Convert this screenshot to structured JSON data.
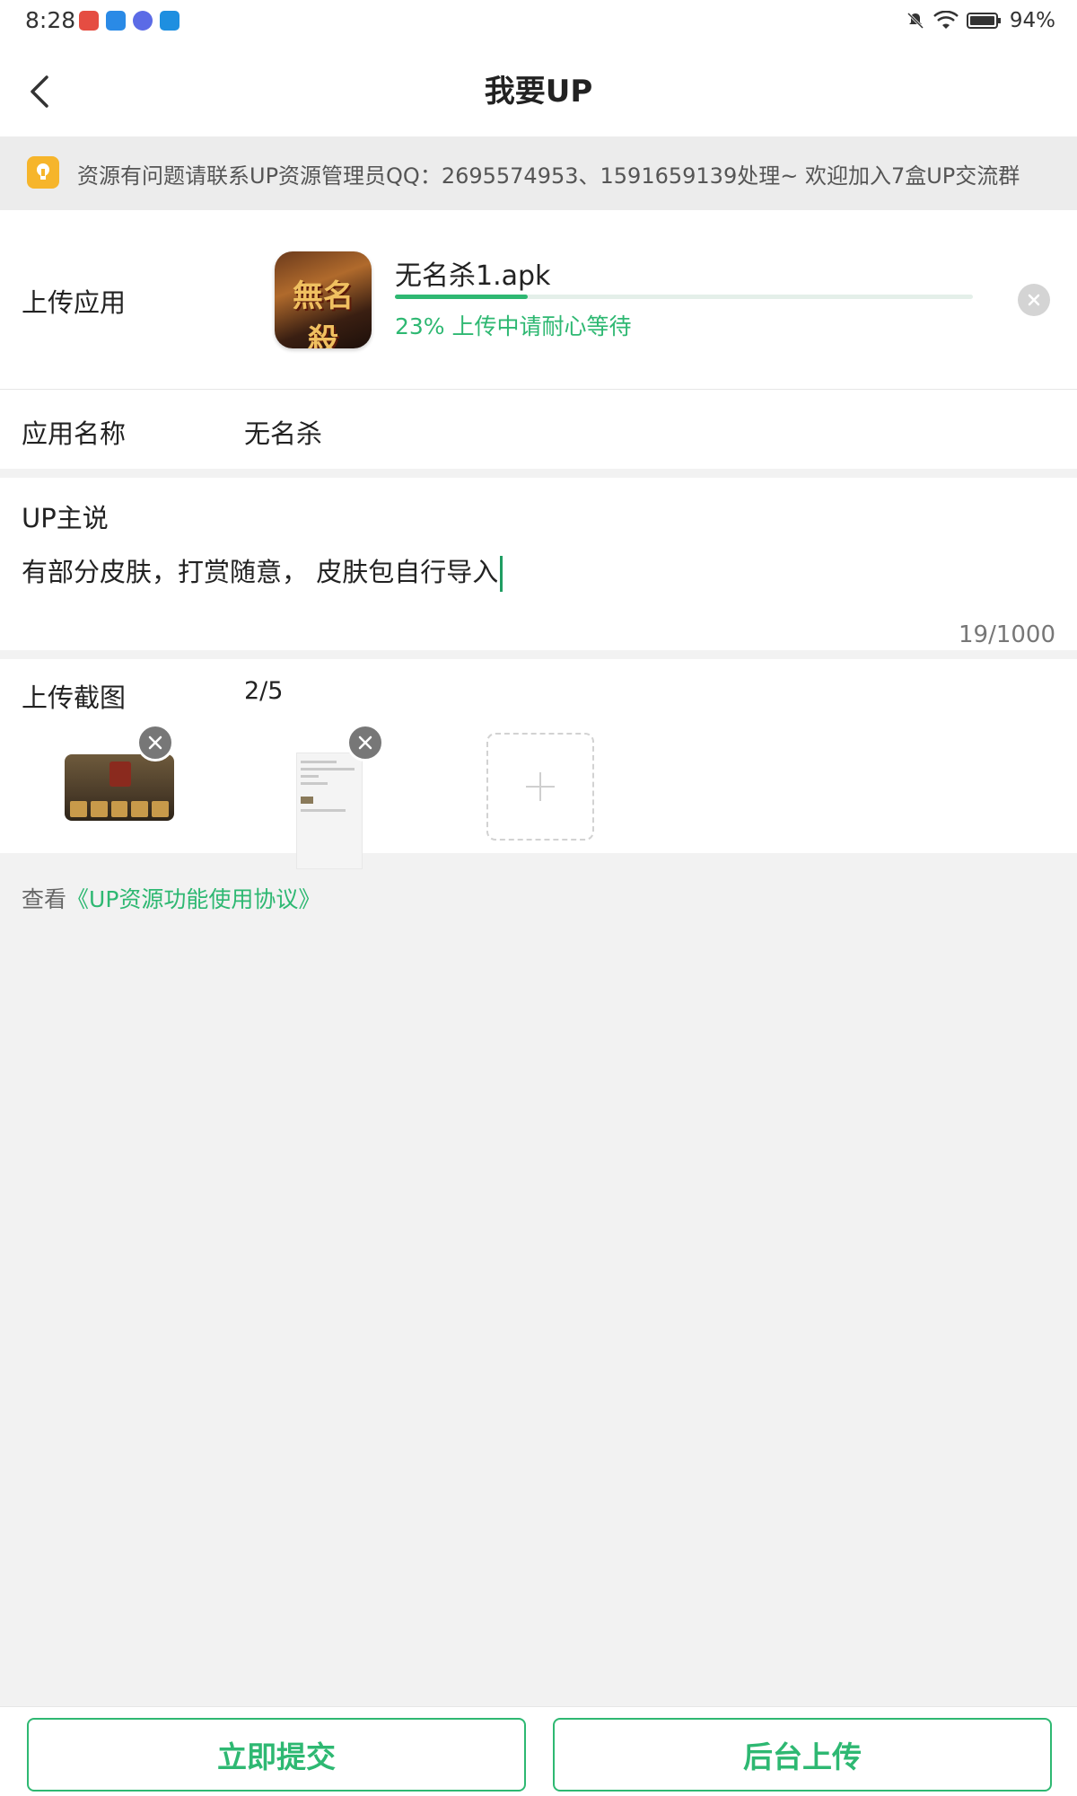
{
  "status_bar": {
    "time": "8:28",
    "battery": "94%",
    "notif_colors": [
      "#e54d42",
      "#2a8ae6",
      "#5b6be6",
      "#1e8fe0"
    ]
  },
  "header": {
    "title": "我要UP",
    "back_icon": "chevron-left-icon"
  },
  "notice": {
    "icon": "bulb-icon",
    "text": "资源有问题请联系UP资源管理员QQ：2695574953、1591659139处理~    欢迎加入7盒UP交流群"
  },
  "upload_app": {
    "label": "上传应用",
    "file_name": "无名杀1.apk",
    "progress": 0.23,
    "progress_text": "23% 上传中请耐心等待",
    "icon_glyph": "無名殺"
  },
  "app_name": {
    "label": "应用名称",
    "value": "无名杀"
  },
  "up_talk": {
    "label": "UP主说",
    "text": "有部分皮肤，打赏随意， 皮肤包自行导入",
    "counter": "19/1000"
  },
  "screenshots": {
    "label": "上传截图",
    "count": "2/5"
  },
  "agreement": {
    "prefix": "查看",
    "link": "《UP资源功能使用协议》"
  },
  "buttons": {
    "submit": "立即提交",
    "background_upload": "后台上传"
  },
  "colors": {
    "accent": "#2eb872",
    "notice_icon": "#f6b52b"
  }
}
